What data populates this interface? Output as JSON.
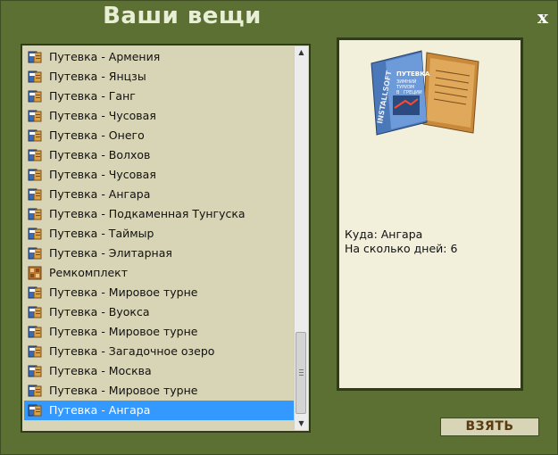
{
  "window": {
    "title": "Ваши вещи",
    "close_label": "x"
  },
  "items": [
    {
      "label": "Путевка - Армения",
      "icon": "voucher-icon"
    },
    {
      "label": "Путевка - Янцзы",
      "icon": "voucher-icon"
    },
    {
      "label": "Путевка - Ганг",
      "icon": "voucher-icon"
    },
    {
      "label": "Путевка - Чусовая",
      "icon": "voucher-icon"
    },
    {
      "label": "Путевка - Онего",
      "icon": "voucher-icon"
    },
    {
      "label": "Путевка - Волхов",
      "icon": "voucher-icon"
    },
    {
      "label": "Путевка - Чусовая",
      "icon": "voucher-icon"
    },
    {
      "label": "Путевка - Ангара",
      "icon": "voucher-icon"
    },
    {
      "label": "Путевка - Подкаменная Тунгуска",
      "icon": "voucher-icon"
    },
    {
      "label": "Путевка - Таймыр",
      "icon": "voucher-icon"
    },
    {
      "label": "Путевка - Элитарная",
      "icon": "voucher-icon"
    },
    {
      "label": "Ремкомплект",
      "icon": "repair-kit-icon"
    },
    {
      "label": "Путевка - Мировое турне",
      "icon": "voucher-icon"
    },
    {
      "label": "Путевка - Вуокса",
      "icon": "voucher-icon"
    },
    {
      "label": "Путевка - Мировое турне",
      "icon": "voucher-icon"
    },
    {
      "label": "Путевка - Загадочное озеро",
      "icon": "voucher-icon"
    },
    {
      "label": "Путевка - Москва",
      "icon": "voucher-icon"
    },
    {
      "label": "Путевка - Мировое турне",
      "icon": "voucher-icon"
    },
    {
      "label": "Путевка - Ангара",
      "icon": "voucher-icon",
      "selected": true
    }
  ],
  "detail": {
    "image_icon": "travel-brochure-icon",
    "brochure_text": {
      "brand": "INSTALLSOFT",
      "title": "ПУТЕВКА",
      "line1": "ЗИМНИЙ",
      "line2": "ТУРИЗМ",
      "line3": "В",
      "line4": "ГРЕЦИИ"
    },
    "destination_line": "Куда: Ангара",
    "days_line": "На сколько дней: 6"
  },
  "actions": {
    "take_label": "ВЗЯТЬ"
  },
  "colors": {
    "window_bg": "#5c7033",
    "panel_bg": "#d8d4b6",
    "detail_bg": "#f2efdb",
    "selection": "#3399ff",
    "title_text": "#e8efd6",
    "button_text": "#5a3a10"
  }
}
